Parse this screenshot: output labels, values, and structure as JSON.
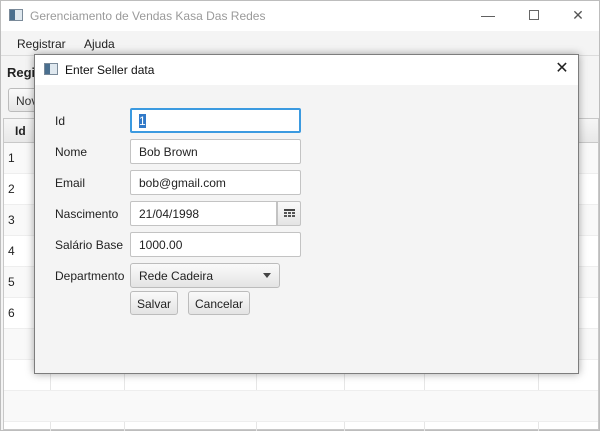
{
  "window": {
    "title": "Gerenciamento de Vendas Kasa Das Redes",
    "minimize_glyph": "—",
    "close_glyph": "✕"
  },
  "menu": {
    "items": [
      "Registrar",
      "Ajuda"
    ]
  },
  "main": {
    "page_title": "Regi",
    "new_button_label": "Nov",
    "table": {
      "header_id": "Id",
      "rows": [
        "1",
        "2",
        "3",
        "4",
        "5",
        "6"
      ]
    }
  },
  "dialog": {
    "title": "Enter Seller data",
    "close_glyph": "✕",
    "labels": {
      "id": "Id",
      "name": "Nome",
      "email": "Email",
      "birth": "Nascimento",
      "salary": "Salário Base",
      "department": "Departmento"
    },
    "values": {
      "id": "1",
      "name": "Bob Brown",
      "email": "bob@gmail.com",
      "birth": "21/04/1998",
      "salary": "1000.00",
      "department": "Rede Cadeira"
    },
    "buttons": {
      "save": "Salvar",
      "cancel": "Cancelar"
    }
  },
  "colors": {
    "focus": "#3b9ae0",
    "selection": "#3179c8"
  },
  "icons": [
    "app-icon",
    "calendar-icon",
    "chevron-down-icon",
    "close-icon"
  ]
}
